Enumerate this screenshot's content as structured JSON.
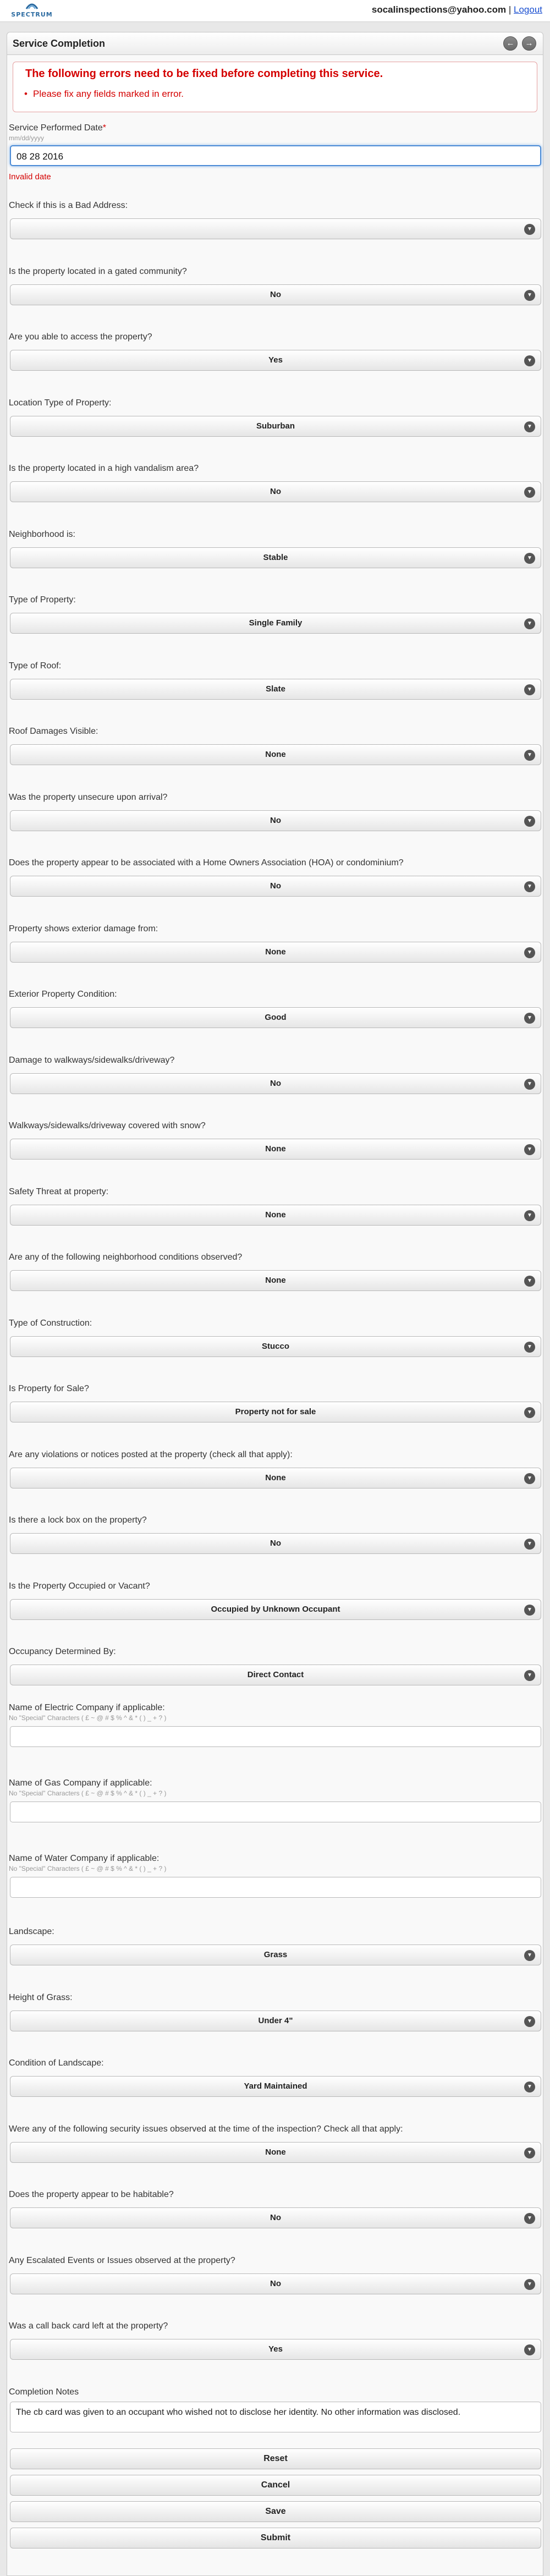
{
  "top": {
    "logo_text": "SPECTRUM",
    "email": "socalinspections@yahoo.com",
    "logout": "Logout"
  },
  "header": {
    "title": "Service Completion",
    "back_icon": "back-arrow-icon",
    "home_icon": "forward-arrow-icon"
  },
  "errors": {
    "title": "The following errors need to be fixed before completing this service.",
    "item": "Please fix any fields marked in error."
  },
  "service_date": {
    "label": "Service Performed Date",
    "hint": "mm/dd/yyyy",
    "value": "08 28 2016",
    "error": "Invalid date"
  },
  "questions": [
    {
      "label": "Check if this is a Bad Address:",
      "value": ""
    },
    {
      "label": "Is the property located in a gated community?",
      "value": "No"
    },
    {
      "label": "Are you able to access the property?",
      "value": "Yes"
    },
    {
      "label": "Location Type of Property:",
      "value": "Suburban"
    },
    {
      "label": "Is the property located in a high vandalism area?",
      "value": "No"
    },
    {
      "label": "Neighborhood is:",
      "value": "Stable"
    },
    {
      "label": "Type of Property:",
      "value": "Single Family"
    },
    {
      "label": "Type of Roof:",
      "value": "Slate"
    },
    {
      "label": "Roof Damages Visible:",
      "value": "None"
    },
    {
      "label": "Was the property unsecure upon arrival?",
      "value": "No"
    },
    {
      "label": "Does the property appear to be associated with a Home Owners Association (HOA) or condominium?",
      "value": "No"
    },
    {
      "label": "Property shows exterior damage from:",
      "value": "None"
    },
    {
      "label": "Exterior Property Condition:",
      "value": "Good"
    },
    {
      "label": "Damage to walkways/sidewalks/driveway?",
      "value": "No"
    },
    {
      "label": "Walkways/sidewalks/driveway covered with snow?",
      "value": "None"
    },
    {
      "label": "Safety Threat at property:",
      "value": "None"
    },
    {
      "label": "Are any of the following neighborhood conditions observed?",
      "value": "None"
    },
    {
      "label": "Type of Construction:",
      "value": "Stucco"
    },
    {
      "label": "Is Property for Sale?",
      "value": "Property not for sale"
    },
    {
      "label": "Are any violations or notices posted at the property (check all that apply):",
      "value": "None"
    },
    {
      "label": "Is there a lock box on the property?",
      "value": "No"
    },
    {
      "label": "Is the Property Occupied or Vacant?",
      "value": "Occupied by Unknown Occupant"
    },
    {
      "label": "Occupancy Determined By:",
      "value": "Direct Contact"
    }
  ],
  "companies": [
    {
      "label": "Name of Electric Company if applicable:",
      "hint": "No \"Special\" Characters ( £ ~ @ # $ % ^ & * ( ) _ + ? )",
      "value": ""
    },
    {
      "label": "Name of Gas Company if applicable:",
      "hint": "No \"Special\" Characters ( £ ~ @ # $ % ^ & * ( ) _ + ? )",
      "value": ""
    },
    {
      "label": "Name of Water Company if applicable:",
      "hint": "No \"Special\" Characters ( £ ~ @ # $ % ^ & * ( ) _ + ? )",
      "value": ""
    }
  ],
  "questions2": [
    {
      "label": "Landscape:",
      "value": "Grass"
    },
    {
      "label": "Height of Grass:",
      "value": "Under 4\""
    },
    {
      "label": "Condition of Landscape:",
      "value": "Yard Maintained"
    },
    {
      "label": "Were any of the following security issues observed at the time of the inspection? Check all that apply:",
      "value": "None"
    },
    {
      "label": "Does the property appear to be habitable?",
      "value": "No"
    },
    {
      "label": "Any Escalated Events or Issues observed at the property?",
      "value": "No"
    },
    {
      "label": "Was a call back card left at the property?",
      "value": "Yes"
    }
  ],
  "notes": {
    "label": "Completion Notes",
    "value": "The cb card was given to an occupant who wished not to disclose her identity.  No other information was disclosed."
  },
  "buttons": {
    "reset": "Reset",
    "cancel": "Cancel",
    "save": "Save",
    "submit": "Submit"
  }
}
